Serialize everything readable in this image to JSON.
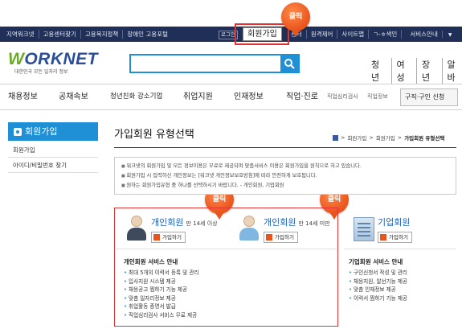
{
  "topbar": {
    "left_links": [
      "지역워크넷",
      "고용센터찾기",
      "고용복지정책",
      "장애인 고용포털"
    ],
    "login": "로그인",
    "join": "회원가입",
    "right_links": [
      "센터",
      "원격제어",
      "사이트맵",
      "ㄱ-ㅎ색인",
      "서비스안내"
    ]
  },
  "badges": [
    "클릭",
    "클릭",
    "클릭"
  ],
  "header": {
    "logo_text": "WORKNET",
    "logo_sub": "대한민국 모든 일자리 정보",
    "search_placeholder": "",
    "quick_links": [
      "청년",
      "여성",
      "장년",
      "알바"
    ]
  },
  "gnb": {
    "items": [
      "채용정보",
      "공채속보",
      "청년친화 강소기업",
      "취업지원",
      "인재정보",
      "직업·진로"
    ],
    "small_items": [
      "직업심리검사",
      "직업정보"
    ],
    "cta": "구직·구인 신청"
  },
  "sidebar": {
    "title": "회원가입",
    "items": [
      "회원가입",
      "아이디/비밀번호 찾기"
    ]
  },
  "main": {
    "title": "가입회원 유형선택",
    "breadcrumb": [
      "회원가입",
      "회원가입",
      "가입회원 유형선택"
    ],
    "notices": [
      "워크넷의 회원가입 및 모든 정보이용은 무료로 제공되며 맞춤서비스 이용은 회원가입을 원칙으로 하고 있습니다.",
      "회원가입 시 입력하신 개인정보는 [워크넷 개인정보보호방침]에 따라 안전하게 보호됩니다.",
      "원하는 회원가입유형 중 하나를 선택하시기 바랍니다. - 개인회원, 기업회원"
    ]
  },
  "cards": {
    "personal_adult": {
      "name": "개인회원",
      "age": "만 14세 이상",
      "button": "가입하기"
    },
    "personal_child": {
      "name": "개인회원",
      "age": "만 14세 미만",
      "button": "가입하기"
    },
    "corporate": {
      "name": "기업회원",
      "button": "가입하기"
    }
  },
  "services": {
    "personal": {
      "title": "개인회원 서비스 안내",
      "items": [
        "최대 5개의 이력서 등록 및 관리",
        "입사지원 시스템 제공",
        "채용공고 찜하기 기능 제공",
        "맞춤 일자리정보 제공",
        "취업활동 증명서 발급",
        "직업심리검사 서비스 무료 제공"
      ]
    },
    "corporate": {
      "title": "기업회원 서비스 안내",
      "items": [
        "구인신청서 작성 및 관리",
        "채용지원, 알선기능 제공",
        "맞춤 인재정보 제공",
        "이력서 찜하기 기능 제공"
      ]
    }
  },
  "colors": {
    "accent_red": "#e43232",
    "brand_blue": "#1f8fd6",
    "badge_orange": "#e9541c",
    "topbar_navy": "#1f2f57"
  }
}
